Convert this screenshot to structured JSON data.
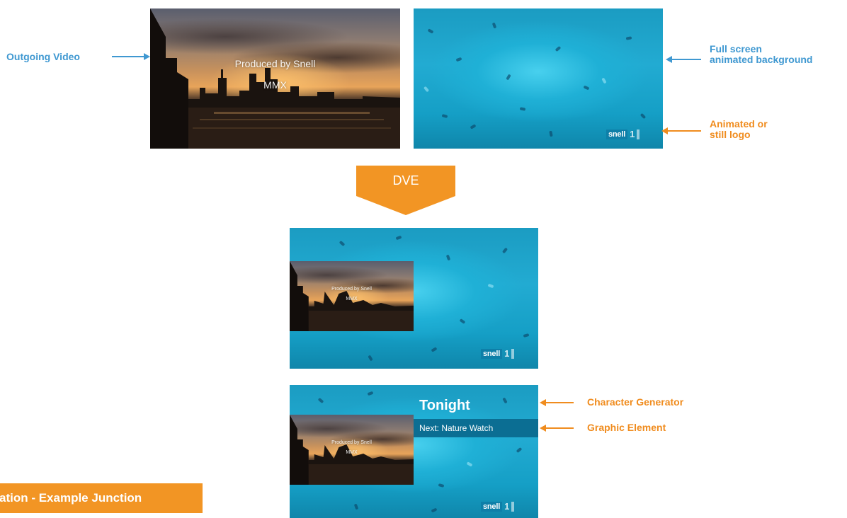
{
  "frames": {
    "outgoing": {
      "caption_line1": "Produced by Snell",
      "caption_line2": "MMX"
    },
    "logo": {
      "word": "snell",
      "number": "1"
    }
  },
  "labels": {
    "outgoing_video": "Outgoing Video",
    "full_screen_line1": "Full screen",
    "full_screen_line2": "animated background",
    "logo_line1": "Animated or",
    "logo_line2": "still logo",
    "character_generator": "Character Generator",
    "graphic_element": "Graphic Element"
  },
  "dve": {
    "label": "DVE"
  },
  "cg": {
    "title": "Tonight",
    "next": "Next: Nature Watch"
  },
  "footer": {
    "text": "ation - Example Junction"
  },
  "colors": {
    "label_blue": "#3f98d1",
    "label_orange": "#f08c1e",
    "accent_orange": "#f29524",
    "graphic_bar": "#0b6e93"
  }
}
